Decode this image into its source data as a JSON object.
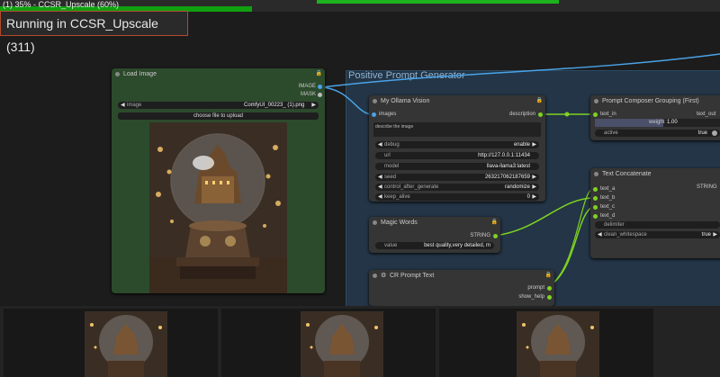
{
  "tab_title": "(1) 35% - CCSR_Upscale (60%)",
  "progress": {
    "overall_percent": 35,
    "node_percent": 60
  },
  "running_label": "Running in CCSR_Upscale (311)",
  "colors": {
    "progress": "#1db31d",
    "link_blue": "#4aa3e8",
    "link_green": "#7ed321",
    "load_node_bg": "#2c4a2c",
    "group_bg": "#233546",
    "lock": "#e6b600"
  },
  "group": {
    "title": "Positive Prompt Generator"
  },
  "load_image": {
    "title": "Load Image",
    "outputs": [
      "IMAGE",
      "MASK"
    ],
    "image_label": "image",
    "image_value": "ComfyUI_00223_ (1).png",
    "upload_label": "choose file to upload"
  },
  "ollama": {
    "title": "My Ollama Vision",
    "input": "images",
    "output": "description",
    "prompt_text": "describe the image",
    "widgets": [
      {
        "label": "debug",
        "value": "enable"
      },
      {
        "label": "url",
        "value": "http://127.0.0.1:11434"
      },
      {
        "label": "model",
        "value": "llava-llama3:latest"
      },
      {
        "label": "seed",
        "value": "263217062187659"
      },
      {
        "label": "control_after_generate",
        "value": "randomize"
      },
      {
        "label": "keep_alive",
        "value": "0"
      }
    ]
  },
  "magic": {
    "title": "Magic Words",
    "output": "STRING",
    "widget": {
      "label": "value",
      "value": "best quality,very detailed, m"
    }
  },
  "crprompt": {
    "title": "CR Prompt Text",
    "outputs": [
      "prompt",
      "show_help"
    ]
  },
  "composer": {
    "title": "Prompt Composer Grouping (First)",
    "input": "text_in",
    "output": "text_out",
    "weight_label": "weight",
    "weight_value": "1.00",
    "active_label": "active",
    "active_value": "true"
  },
  "concat": {
    "title": "Text Concatenate",
    "inputs": [
      "text_a",
      "text_b",
      "text_c",
      "text_d"
    ],
    "output": "STRING",
    "widgets": [
      {
        "label": "delimiter",
        "value": ""
      },
      {
        "label": "clean_whitespace",
        "value": "true"
      }
    ]
  },
  "icons": [
    "lock-icon",
    "gear-icon",
    "left-arrow-icon",
    "right-arrow-icon",
    "toggle-icon"
  ]
}
